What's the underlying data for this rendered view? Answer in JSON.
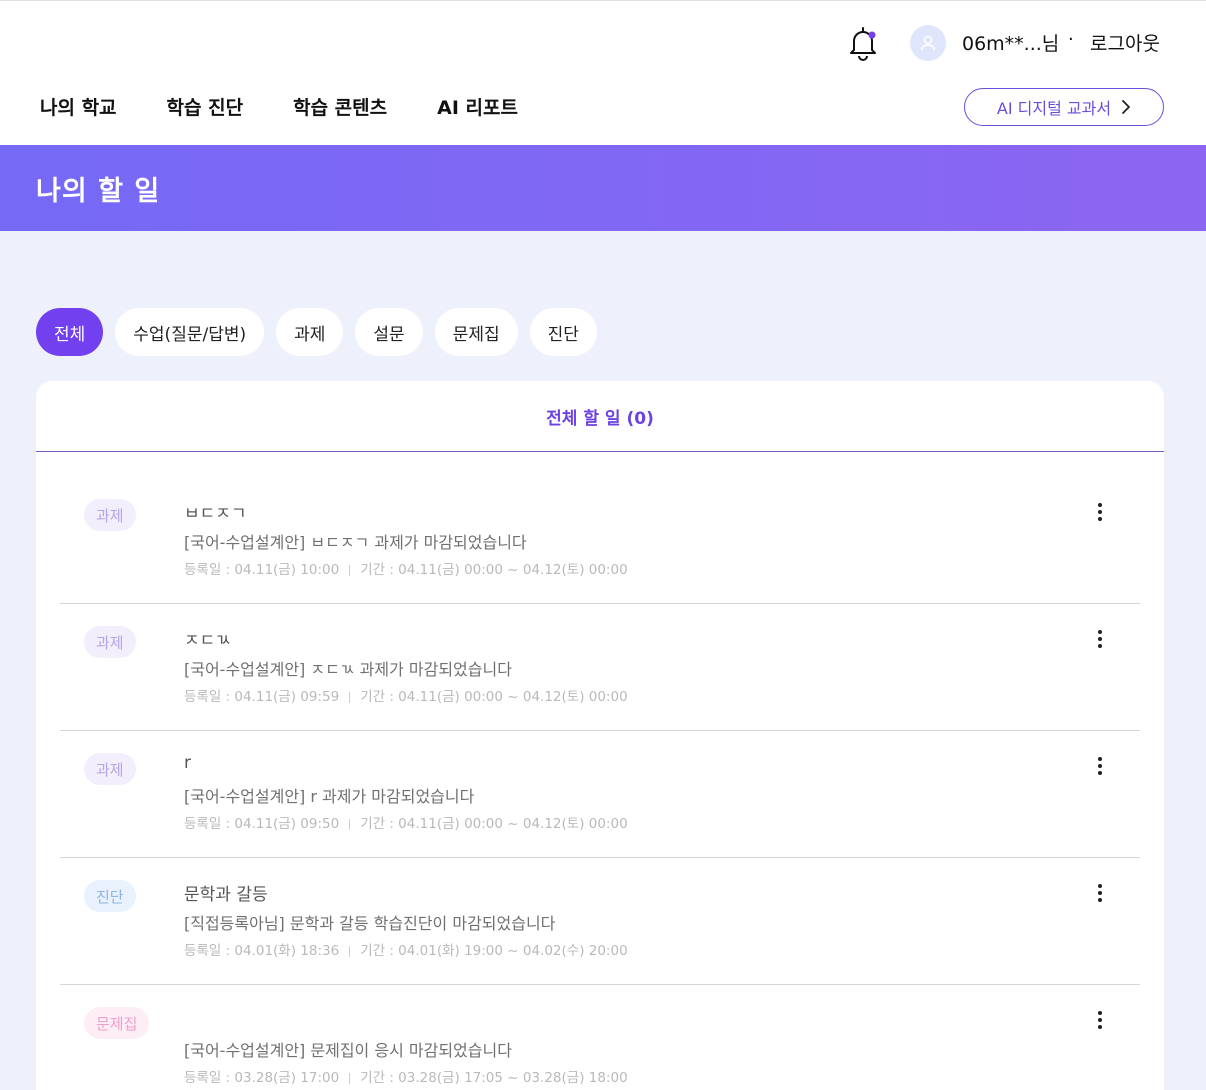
{
  "header": {
    "user_name": "06m**...님",
    "separator": "·",
    "logout_label": "로그아웃",
    "nav": [
      {
        "label": "나의 학교"
      },
      {
        "label": "학습 진단"
      },
      {
        "label": "학습 콘텐츠"
      },
      {
        "label": "AI 리포트"
      }
    ],
    "textbook_button": "AI 디지털 교과서"
  },
  "banner": {
    "title": "나의 할 일"
  },
  "filters": [
    {
      "label": "전체",
      "active": true
    },
    {
      "label": "수업(질문/답변)",
      "active": false
    },
    {
      "label": "과제",
      "active": false
    },
    {
      "label": "설문",
      "active": false
    },
    {
      "label": "문제집",
      "active": false
    },
    {
      "label": "진단",
      "active": false
    }
  ],
  "panel": {
    "title": "전체 할 일 (0)"
  },
  "tasks": [
    {
      "tag": "과제",
      "title": "ㅂㄷㅈㄱ",
      "desc": "[국어-수업설계안] ㅂㄷㅈㄱ 과제가 마감되었습니다",
      "registered": "등록일 : 04.11(금) 10:00",
      "period": "기간 : 04.11(금) 00:00 ~ 04.12(토) 00:00"
    },
    {
      "tag": "과제",
      "title": "ㅈㄷㄳ",
      "desc": "[국어-수업설계안] ㅈㄷㄳ 과제가 마감되었습니다",
      "registered": "등록일 : 04.11(금) 09:59",
      "period": "기간 : 04.11(금) 00:00 ~ 04.12(토) 00:00"
    },
    {
      "tag": "과제",
      "title": "r",
      "desc": "[국어-수업설계안] r 과제가 마감되었습니다",
      "registered": "등록일 : 04.11(금) 09:50",
      "period": "기간 : 04.11(금) 00:00 ~ 04.12(토) 00:00"
    },
    {
      "tag": "진단",
      "title": "문학과 갈등",
      "desc": "[직접등록아님] 문학과 갈등 학습진단이 마감되었습니다",
      "registered": "등록일 : 04.01(화) 18:36",
      "period": "기간 : 04.01(화) 19:00 ~ 04.02(수) 20:00"
    },
    {
      "tag": "문제집",
      "title": "",
      "desc": "[국어-수업설계안] 문제집이 응시 마감되었습니다",
      "registered": "등록일 : 03.28(금) 17:00",
      "period": "기간 : 03.28(금) 17:05 ~ 03.28(금) 18:00"
    }
  ],
  "colors": {
    "accent": "#7240ee",
    "banner_start": "#7569f6",
    "banner_end": "#8c66f2",
    "tag_task": "#b4a6e6",
    "tag_diag": "#8cb3ea",
    "tag_quiz": "#ef9fcb"
  }
}
